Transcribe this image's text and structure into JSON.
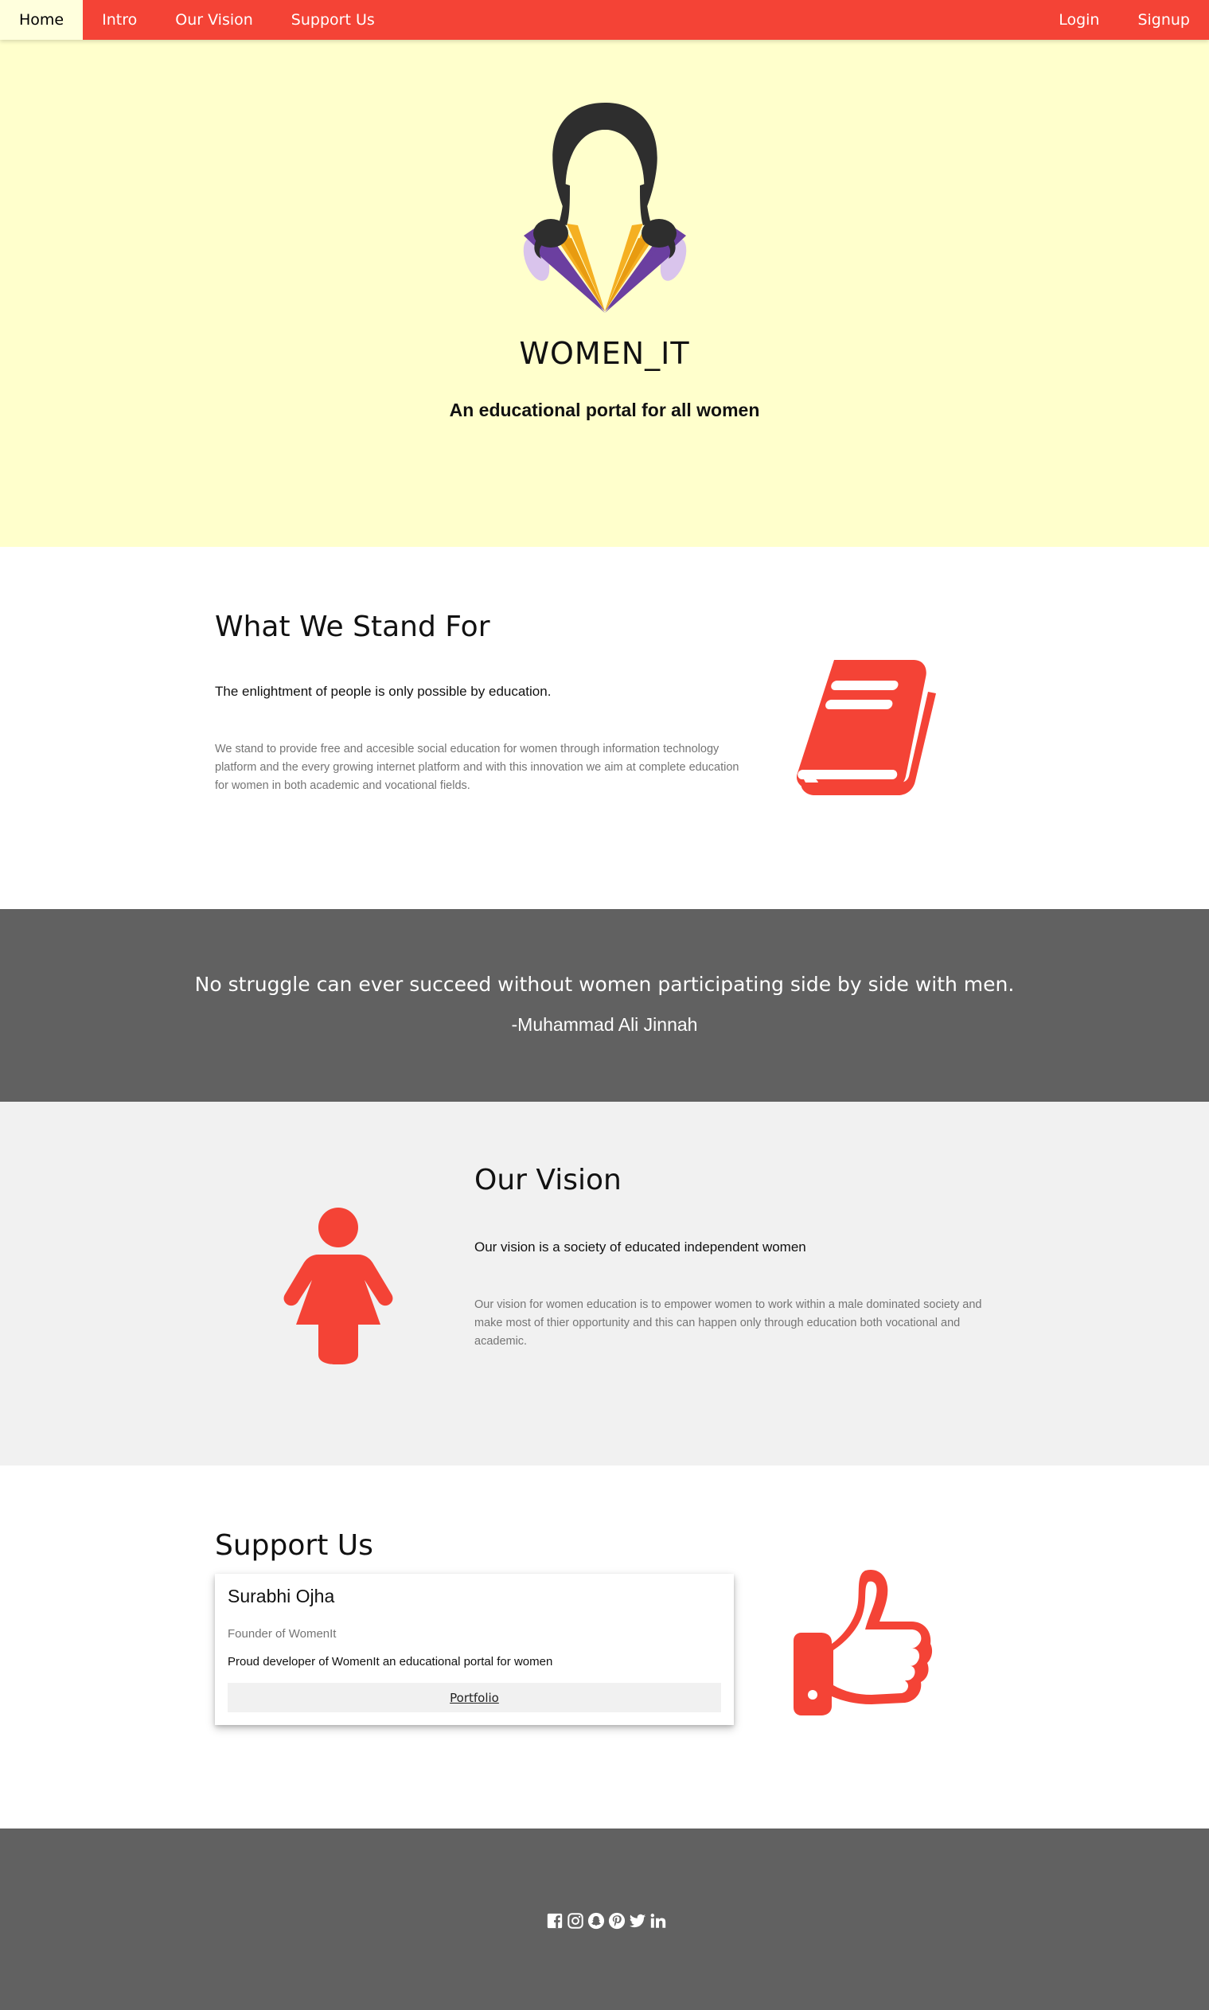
{
  "nav": {
    "left": [
      "Home",
      "Intro",
      "Our Vision",
      "Support Us"
    ],
    "right": [
      "Login",
      "Signup"
    ],
    "active": "Home"
  },
  "hero": {
    "title": "WOMEN_IT",
    "subtitle": "An educational portal for all women"
  },
  "stand": {
    "title": "What We Stand For",
    "lead": "The enlightment of people is only possible by education.",
    "body": "We stand to provide free and accesible social education for women through information technology platform and the every growing internet platform and with this innovation we aim at complete education for women in both academic and vocational fields."
  },
  "quote": {
    "text": "No struggle can ever succeed without women participating side by side with men.",
    "author": "-Muhammad Ali Jinnah"
  },
  "vision": {
    "title": "Our Vision",
    "lead": "Our vision is a society of educated independent women",
    "body": "Our vision for women education is to empower women to work within a male dominated society and make most of thier opportunity and this can happen only through education both vocational and academic."
  },
  "support": {
    "title": "Support Us",
    "card": {
      "name": "Surabhi Ojha",
      "role": "Founder of WomenIt",
      "description": "Proud developer of WomenIt an educational portal for women",
      "button": "Portfolio"
    }
  },
  "footer": {
    "social_icons": [
      "facebook-icon",
      "instagram-icon",
      "snapchat-icon",
      "pinterest-icon",
      "twitter-icon",
      "linkedin-icon"
    ]
  },
  "colors": {
    "accent": "#f44336",
    "hero_bg": "#ffffcc",
    "dark_bg": "#616161",
    "light_bg": "#f1f1f1",
    "logo_purple": "#6b3fa0",
    "logo_gold": "#f5b022"
  }
}
